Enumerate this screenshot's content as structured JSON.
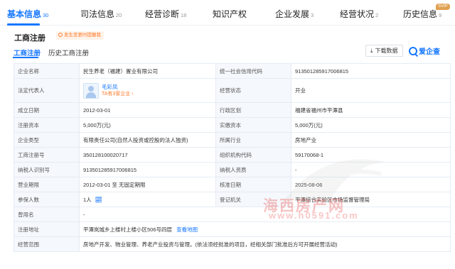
{
  "top_tabs": [
    {
      "label": "基本信息",
      "count": "30"
    },
    {
      "label": "司法信息",
      "count": "20"
    },
    {
      "label": "经营诊断",
      "count": "18"
    },
    {
      "label": "知识产权",
      "count": ""
    },
    {
      "label": "企业发展",
      "count": "3"
    },
    {
      "label": "经营状况",
      "count": "2"
    },
    {
      "label": "历史信息",
      "count": "9"
    }
  ],
  "svip_badge": "SVIP",
  "section": {
    "title": "工商注册",
    "alert": "发生变更时提醒我"
  },
  "sub_tabs": [
    "工商注册",
    "历史工商注册"
  ],
  "actions": {
    "download": "下载数据",
    "brand": "爱企查"
  },
  "rows": {
    "r1": {
      "l1": "企业名称",
      "v1": "民生养老（福建）置业有限公司",
      "l2": "统一社会信用代码",
      "v2": "913501285917006815"
    },
    "r2": {
      "l1": "法定代表人",
      "rep_name": "毛彩凤",
      "rep_sub": "TA有3家企业 ›",
      "l2": "经营状态",
      "v2": "开业"
    },
    "r3": {
      "l1": "成立日期",
      "v1": "2012-03-01",
      "l2": "行政区划",
      "v2": "福建省福州市平潭县"
    },
    "r4": {
      "l1": "注册资本",
      "v1": "5,000万(元)",
      "l2": "实缴资本",
      "v2": "5,000万(元)"
    },
    "r5": {
      "l1": "企业类型",
      "v1": "有限责任公司(自然人投资或控股的法人独资)",
      "l2": "所属行业",
      "v2": "房地产业"
    },
    "r6": {
      "l1": "工商注册号",
      "v1": "350128100020717",
      "l2": "组织机构代码",
      "v2": "59170068-1"
    },
    "r7": {
      "l1": "纳税人识别号",
      "v1": "913501285917006815",
      "l2": "纳税人资质",
      "v2": "-"
    },
    "r8": {
      "l1": "营业期限",
      "v1": "2012-03-01 至 无固定期限",
      "l2": "核准日期",
      "v2": "2025-08-06"
    },
    "r9": {
      "l1": "参保人数",
      "v1": "1人",
      "l2": "登记机关",
      "v2": "平潭综合实验区市场监督管理局"
    },
    "r10": {
      "l1": "曾用名",
      "v1": "-"
    },
    "r11": {
      "l1": "注册地址",
      "v1": "平潭岚城乡上楼村上楼小区506号四层",
      "link": "查看地图"
    },
    "r12": {
      "l1": "经营范围",
      "v1": "房地产开发、物业管理、养老产业投资与管理。(依法须经批准的项目，经相关部门批准后方可开展经营活动)"
    }
  },
  "watermark": {
    "text": "海西房产网",
    "url": "www.h0591.com"
  },
  "colors": {
    "accent": "#1677ff",
    "warning": "#ff7a2a",
    "label_bg": "#f5f8fc",
    "border": "#e6ecf4",
    "watermark": "#e84a4a"
  }
}
